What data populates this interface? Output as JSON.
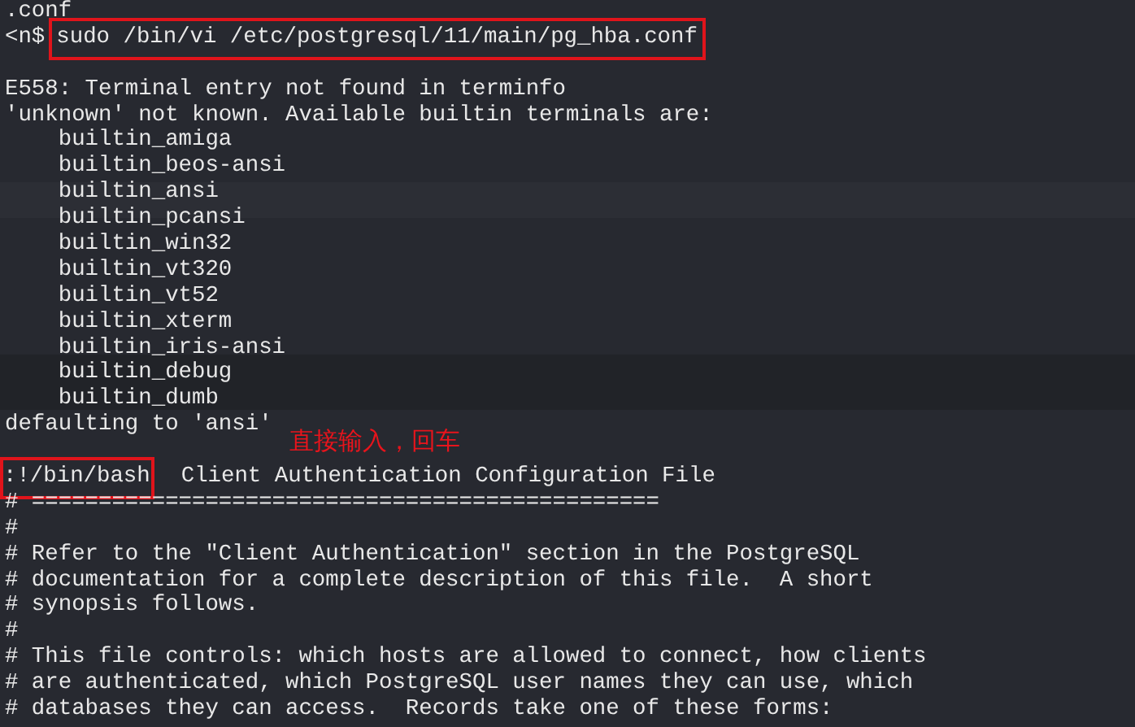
{
  "terminal": {
    "lines": [
      {
        "kind": "text",
        "text": ".conf"
      },
      {
        "kind": "prompt",
        "prompt": "<n$",
        "command": "sudo /bin/vi /etc/postgresql/11/main/pg_hba.conf",
        "highlighted": true
      },
      {
        "kind": "blank"
      },
      {
        "kind": "text",
        "text": "E558: Terminal entry not found in terminfo"
      },
      {
        "kind": "text",
        "text": "'unknown' not known. Available builtin terminals are:"
      },
      {
        "kind": "text",
        "text": "    builtin_amiga"
      },
      {
        "kind": "text",
        "text": "    builtin_beos-ansi"
      },
      {
        "kind": "text",
        "text": "    builtin_ansi"
      },
      {
        "kind": "text",
        "text": "    builtin_pcansi"
      },
      {
        "kind": "text",
        "text": "    builtin_win32"
      },
      {
        "kind": "text",
        "text": "    builtin_vt320"
      },
      {
        "kind": "text",
        "text": "    builtin_vt52"
      },
      {
        "kind": "text",
        "text": "    builtin_xterm"
      },
      {
        "kind": "text",
        "text": "    builtin_iris-ansi"
      },
      {
        "kind": "text",
        "text": "    builtin_debug"
      },
      {
        "kind": "text",
        "text": "    builtin_dumb"
      },
      {
        "kind": "text",
        "text": "defaulting to 'ansi'"
      },
      {
        "kind": "blank"
      },
      {
        "kind": "vi_command",
        "command": ":!/bin/bash",
        "text": "Client Authentication Configuration File",
        "highlighted": true
      },
      {
        "kind": "text",
        "text": "# ==============================================="
      },
      {
        "kind": "text",
        "text": "#"
      },
      {
        "kind": "text",
        "text": "# Refer to the \"Client Authentication\" section in the PostgreSQL"
      },
      {
        "kind": "text",
        "text": "# documentation for a complete description of this file.  A short"
      },
      {
        "kind": "text",
        "text": "# synopsis follows."
      },
      {
        "kind": "text",
        "text": "#"
      },
      {
        "kind": "text",
        "text": "# This file controls: which hosts are allowed to connect, how clients"
      },
      {
        "kind": "text",
        "text": "# are authenticated, which PostgreSQL user names they can use, which"
      },
      {
        "kind": "text",
        "text": "# databases they can access.  Records take one of these forms:"
      }
    ]
  },
  "annotation": {
    "text": "直接输入，回车"
  }
}
